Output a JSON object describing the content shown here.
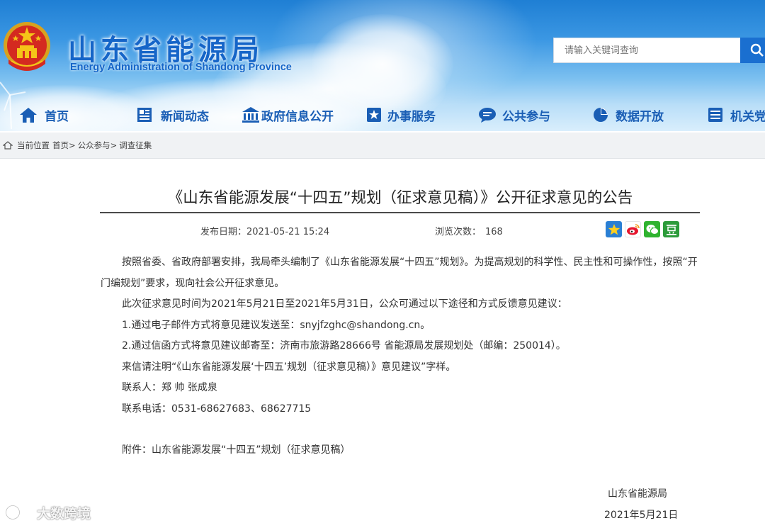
{
  "header": {
    "title": "山东省能源局",
    "subtitle": "Energy Administration of Shandong Province"
  },
  "search": {
    "placeholder": "请输入关键词查询"
  },
  "nav": {
    "items": [
      {
        "label": "首页",
        "icon": "home-icon"
      },
      {
        "label": "新闻动态",
        "icon": "news-icon"
      },
      {
        "label": "政府信息公开",
        "icon": "government-building-icon"
      },
      {
        "label": "办事服务",
        "icon": "service-icon"
      },
      {
        "label": "公共参与",
        "icon": "chat-bubble-icon"
      },
      {
        "label": "数据开放",
        "icon": "pie-chart-icon"
      },
      {
        "label": "机关党",
        "icon": "party-icon"
      }
    ]
  },
  "breadcrumb": {
    "prefix": "当前位置",
    "items": [
      "首页",
      "公众参与",
      "调查征集"
    ],
    "separator": ">"
  },
  "article": {
    "title": "《山东省能源发展“十四五”规划（征求意见稿）》公开征求意见的公告",
    "publish_label": "发布日期：",
    "publish_date": "2021-05-21 15:24",
    "views_label": "浏览次数：",
    "views": "168",
    "paragraphs": [
      "按照省委、省政府部署安排，我局牵头编制了《山东省能源发展“十四五”规划》。为提高规划的科学性、民主性和可操作性，按照“开门编规划”要求，现向社会公开征求意见。",
      "此次征求意见时间为2021年5月21日至2021年5月31日，公众可通过以下途径和方式反馈意见建议：",
      "1.通过电子邮件方式将意见建议发送至：snyjfzghc@shandong.cn。",
      "2.通过信函方式将意见建议邮寄至：济南市旅游路28666号 省能源局发展规划处（邮编：250014）。",
      "来信请注明“《山东省能源发展‘十四五’规划（征求意见稿）》意见建议”字样。",
      "联系人：郑 帅  张成泉",
      "联系电话：0531-68627683、68627715"
    ],
    "attachment": "附件：山东省能源发展“十四五”规划（征求意见稿）",
    "sign_org": "山东省能源局",
    "sign_date": "2021年5月21日"
  },
  "share": {
    "icons": [
      "qzone-star-icon",
      "weibo-icon",
      "wechat-icon",
      "douban-icon"
    ]
  },
  "watermark": {
    "text": "大数跨境"
  },
  "colors": {
    "brand_blue": "#1565c8",
    "nav_text": "#1a5eb5",
    "search_button": "#1a6fd0"
  }
}
